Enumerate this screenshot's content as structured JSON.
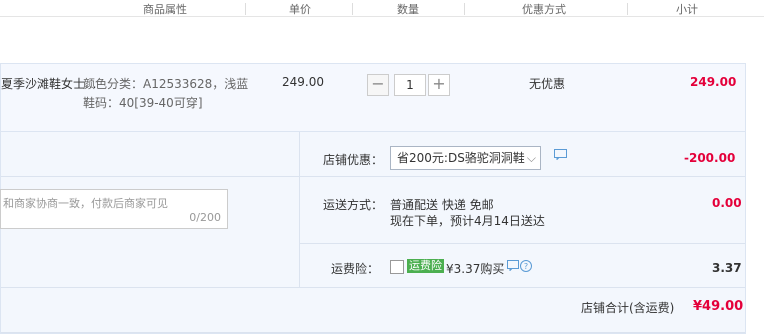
{
  "header": {
    "col_attr": "商品属性",
    "col_price": "单价",
    "col_qty": "数量",
    "col_promo": "优惠方式",
    "col_subtotal": "小计"
  },
  "item": {
    "title": "夏季沙滩鞋女士...",
    "attr_color": "颜色分类：A12533628，浅蓝",
    "attr_size": "鞋码：40[39-40可穿]",
    "price": "249.00",
    "qty": "1",
    "promo": "无优惠",
    "subtotal": "249.00"
  },
  "store": {
    "discount_label": "店铺优惠：",
    "discount_select": "省200元:DS骆驼洞洞鞋",
    "discount_amount": "-200.00",
    "shipping_label": "运送方式：",
    "shipping_method": "普通配送 快递 免邮",
    "shipping_eta": "现在下单，预计4月14日送达",
    "shipping_amount": "0.00",
    "insurance_label": "运费险：",
    "insurance_tag": "运费险",
    "insurance_price": "¥3.37购买",
    "insurance_amount": "3.37",
    "total_label": "店铺合计(含运费)",
    "total_amount": "¥49.00"
  },
  "memo": {
    "placeholder": "和商家协商一致，付款后商家可见",
    "counter": "0/200"
  },
  "colors": {
    "price_red": "#e4003a",
    "accent_blue": "#3c8ee0",
    "tag_green": "#4caf50"
  }
}
